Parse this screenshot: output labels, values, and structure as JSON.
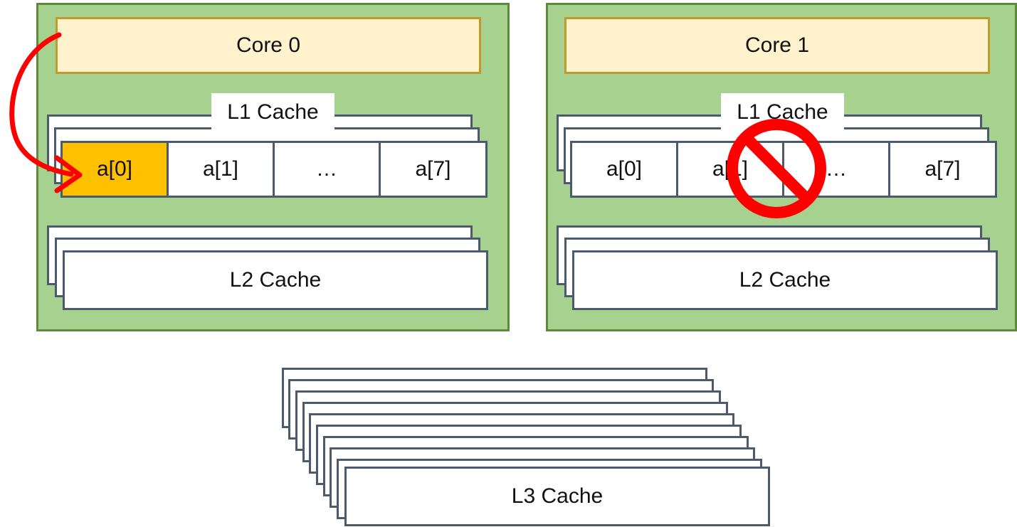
{
  "colors": {
    "core_panel_bg": "#a7d18f",
    "core_bar_bg": "#fff2cc",
    "highlight_cell_bg": "#ffc000",
    "arrow": "#ff0000",
    "prohibit": "#ff0000"
  },
  "cores": [
    {
      "title": "Core 0",
      "l1_label": "L1 Cache",
      "l1_cells": [
        "a[0]",
        "a[1]",
        "…",
        "a[7]"
      ],
      "l2_label": "L2 Cache"
    },
    {
      "title": "Core 1",
      "l1_label": "L1 Cache",
      "l1_cells": [
        "a[0]",
        "a[1]",
        "…",
        "a[7]"
      ],
      "l2_label": "L2 Cache"
    }
  ],
  "l3_label": "L3 Cache",
  "icons": {
    "access_arrow": "curved-arrow-icon",
    "prohibited": "prohibition-icon"
  }
}
